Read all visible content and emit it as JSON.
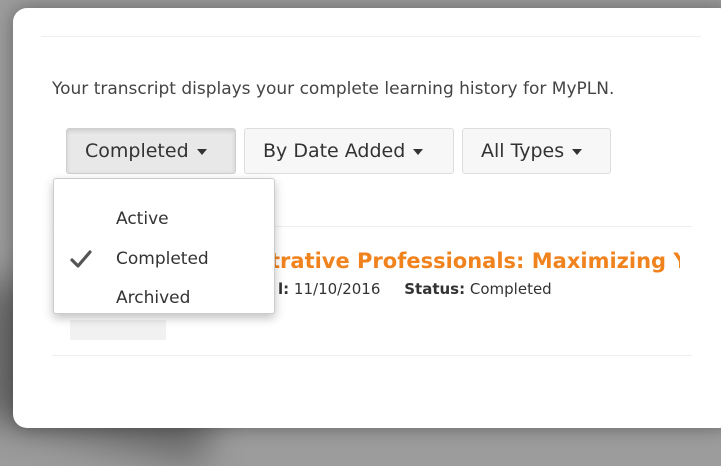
{
  "transcript": {
    "intro": "Your transcript displays your complete learning history for MyPLN."
  },
  "filters": {
    "status": "Completed",
    "sort": "By Date Added",
    "type": "All Types"
  },
  "dropdown": {
    "items": [
      {
        "label": "Active",
        "checked": false
      },
      {
        "label": "Completed",
        "checked": true
      },
      {
        "label": "Archived",
        "checked": false
      }
    ]
  },
  "item": {
    "title": "trative Professionals: Maximizing Yo",
    "date_label_tail": "l:",
    "date": "11/10/2016",
    "status_label": "Status:",
    "status": "Completed"
  },
  "colors": {
    "accent": "#f0831e",
    "background": "#9c9c9c"
  },
  "icons": {
    "check": "check-icon",
    "caret": "caret-down-icon"
  }
}
